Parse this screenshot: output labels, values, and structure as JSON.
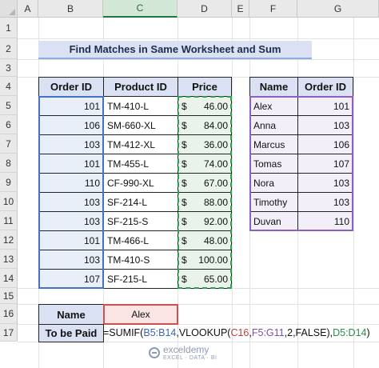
{
  "columns": [
    "A",
    "B",
    "C",
    "D",
    "E",
    "F",
    "G"
  ],
  "rows": [
    "1",
    "2",
    "3",
    "4",
    "5",
    "6",
    "7",
    "8",
    "9",
    "10",
    "11",
    "12",
    "13",
    "14",
    "15",
    "16",
    "17"
  ],
  "title": "Find Matches in Same Worksheet and Sum",
  "orders": {
    "headers": [
      "Order ID",
      "Product ID",
      "Price"
    ],
    "rows": [
      {
        "id": "101",
        "product": "TM-410-L",
        "currency": "$",
        "price": "46.00"
      },
      {
        "id": "106",
        "product": "SM-660-XL",
        "currency": "$",
        "price": "84.00"
      },
      {
        "id": "103",
        "product": "TM-412-XL",
        "currency": "$",
        "price": "36.00"
      },
      {
        "id": "101",
        "product": "TM-455-L",
        "currency": "$",
        "price": "74.00"
      },
      {
        "id": "110",
        "product": "CF-990-XL",
        "currency": "$",
        "price": "67.00"
      },
      {
        "id": "103",
        "product": "SF-214-L",
        "currency": "$",
        "price": "88.00"
      },
      {
        "id": "103",
        "product": "SF-215-S",
        "currency": "$",
        "price": "92.00"
      },
      {
        "id": "101",
        "product": "TM-466-L",
        "currency": "$",
        "price": "48.00"
      },
      {
        "id": "103",
        "product": "TM-410-S",
        "currency": "$",
        "price": "100.00"
      },
      {
        "id": "107",
        "product": "SF-215-L",
        "currency": "$",
        "price": "65.00"
      }
    ]
  },
  "people": {
    "headers": [
      "Name",
      "Order ID"
    ],
    "rows": [
      {
        "name": "Alex",
        "id": "101"
      },
      {
        "name": "Anna",
        "id": "103"
      },
      {
        "name": "Marcus",
        "id": "106"
      },
      {
        "name": "Tomas",
        "id": "107"
      },
      {
        "name": "Nora",
        "id": "103"
      },
      {
        "name": "Timothy",
        "id": "103"
      },
      {
        "name": "Duvan",
        "id": "110"
      }
    ]
  },
  "lookup": {
    "name_label": "Name",
    "name_value": "Alex",
    "paid_label": "To be Paid",
    "formula": {
      "p1": "=SUMIF(",
      "p2": "B5:B14",
      "p3": ",VLOOKUP(",
      "p4": "C16",
      "p5": ",",
      "p6": "F5:G11",
      "p7": ",2,FALSE),",
      "p8": "D5:D14",
      "p9": ")"
    }
  },
  "watermark": {
    "name": "exceldemy",
    "tagline": "EXCEL · DATA · BI"
  },
  "colors": {
    "header_fill": "#d9e1f2",
    "blue_range": "#4472c4",
    "green_range": "#2e9e4f",
    "purple_range": "#8e5fc2",
    "red_range": "#d05050"
  }
}
